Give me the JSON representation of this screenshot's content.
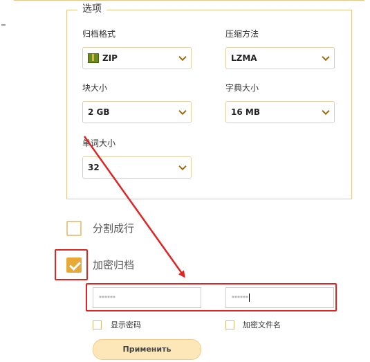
{
  "options": {
    "legend": "选项",
    "archive_format": {
      "label": "归档格式",
      "value": "ZIP",
      "icon": "zip-archive-icon"
    },
    "compression_method": {
      "label": "压缩方法",
      "value": "LZMA"
    },
    "block_size": {
      "label": "块大小",
      "value": "2 GB"
    },
    "dictionary_size": {
      "label": "字典大小",
      "value": "16 MB"
    },
    "word_size": {
      "label": "单词大小",
      "value": "32"
    }
  },
  "split_archive": {
    "label": "分割成行",
    "checked": false
  },
  "encrypt_archive": {
    "label": "加密归档",
    "checked": true
  },
  "passwords": {
    "password": "******",
    "confirm": "******"
  },
  "show_password": {
    "label": "显示密码",
    "checked": false
  },
  "encrypt_filenames": {
    "label": "加密文件名",
    "checked": false
  },
  "apply_button": {
    "label": "Применить"
  },
  "colors": {
    "accent": "#e8a93b",
    "border": "#e8c88a",
    "annotation": "#e02424"
  }
}
